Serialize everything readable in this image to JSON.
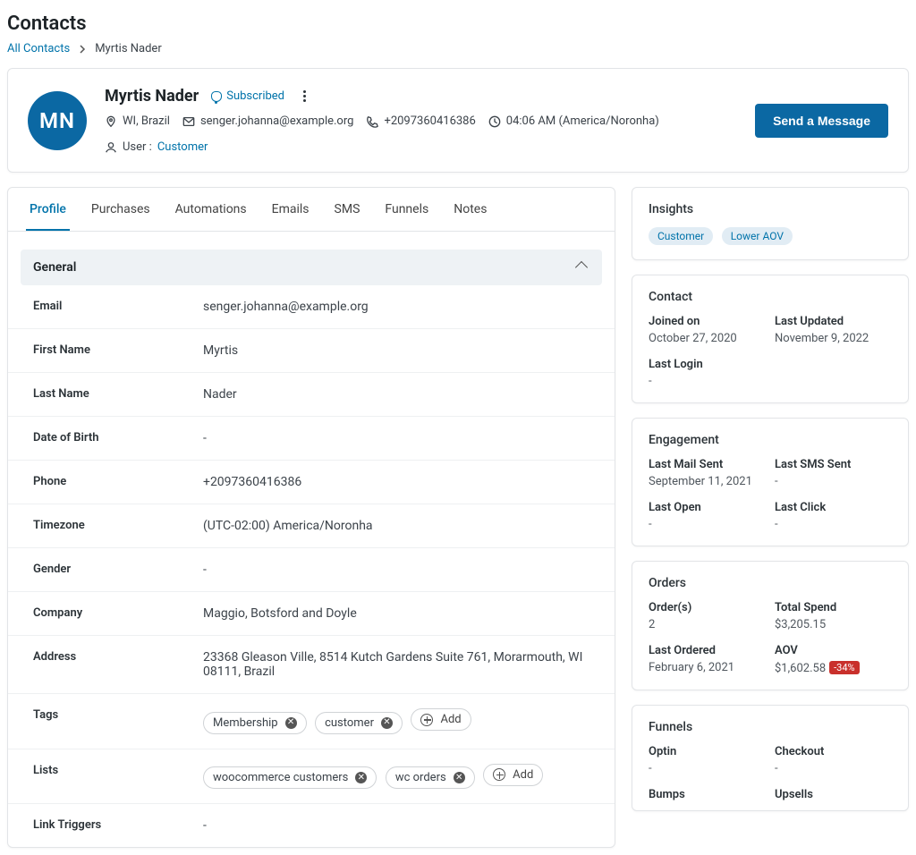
{
  "page": {
    "title": "Contacts"
  },
  "breadcrumb": {
    "all": "All Contacts",
    "current": "Myrtis Nader"
  },
  "header": {
    "initials": "MN",
    "name": "Myrtis Nader",
    "subscribed": "Subscribed",
    "location": "WI, Brazil",
    "email": "senger.johanna@example.org",
    "phone": "+2097360416386",
    "time": "04:06 AM (America/Noronha)",
    "user_label": "User :",
    "user_type": "Customer",
    "send_btn": "Send a Message"
  },
  "tabs": [
    "Profile",
    "Purchases",
    "Automations",
    "Emails",
    "SMS",
    "Funnels",
    "Notes"
  ],
  "section": {
    "general": "General",
    "add": "Add"
  },
  "details": {
    "email_l": "Email",
    "email_v": "senger.johanna@example.org",
    "first_l": "First Name",
    "first_v": "Myrtis",
    "last_l": "Last Name",
    "last_v": "Nader",
    "dob_l": "Date of Birth",
    "dob_v": "-",
    "phone_l": "Phone",
    "phone_v": "+2097360416386",
    "tz_l": "Timezone",
    "tz_v": "(UTC-02:00) America/Noronha",
    "gender_l": "Gender",
    "gender_v": "-",
    "company_l": "Company",
    "company_v": "Maggio, Botsford and Doyle",
    "address_l": "Address",
    "address_v": "23368 Gleason Ville, 8514 Kutch Gardens Suite 761, Morarmouth, WI 08111, Brazil",
    "tags_l": "Tags",
    "lists_l": "Lists",
    "link_l": "Link Triggers",
    "link_v": "-"
  },
  "tags": [
    "Membership",
    "customer"
  ],
  "lists": [
    "woocommerce customers",
    "wc orders"
  ],
  "insights": {
    "title": "Insights",
    "b1": "Customer",
    "b2": "Lower AOV"
  },
  "contact_card": {
    "title": "Contact",
    "joined_l": "Joined on",
    "joined_v": "October 27, 2020",
    "updated_l": "Last Updated",
    "updated_v": "November 9, 2022",
    "login_l": "Last Login",
    "login_v": "-"
  },
  "engagement": {
    "title": "Engagement",
    "mail_l": "Last Mail Sent",
    "mail_v": "September 11, 2021",
    "sms_l": "Last SMS Sent",
    "sms_v": "-",
    "open_l": "Last Open",
    "open_v": "-",
    "click_l": "Last Click",
    "click_v": "-"
  },
  "orders": {
    "title": "Orders",
    "orders_l": "Order(s)",
    "orders_v": "2",
    "spend_l": "Total Spend",
    "spend_v": "$3,205.15",
    "last_l": "Last Ordered",
    "last_v": "February 6, 2021",
    "aov_l": "AOV",
    "aov_v": "$1,602.58",
    "aov_pct": "-34%"
  },
  "funnels": {
    "title": "Funnels",
    "optin_l": "Optin",
    "optin_v": "-",
    "checkout_l": "Checkout",
    "checkout_v": "-",
    "bumps_l": "Bumps",
    "upsells_l": "Upsells"
  }
}
